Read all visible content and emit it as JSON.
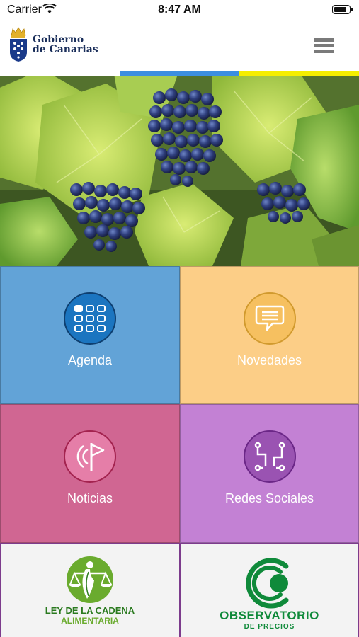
{
  "status_bar": {
    "carrier": "Carrier",
    "time": "8:47 AM"
  },
  "header": {
    "logo_line1": "Gobierno",
    "logo_line2": "de Canarias"
  },
  "tiles": [
    {
      "label": "Agenda",
      "icon": "calendar-grid-icon",
      "bg": "#62a3d7",
      "circle": "#1b75c0"
    },
    {
      "label": "Novedades",
      "icon": "speech-bubble-icon",
      "bg": "#fcce87",
      "circle": "#f6c060"
    },
    {
      "label": "Noticias",
      "icon": "flag-broadcast-icon",
      "bg": "#d06692",
      "circle": "#e57ea8"
    },
    {
      "label": "Redes Sociales",
      "icon": "network-icon",
      "bg": "#c381d4",
      "circle": "#9a53b2"
    }
  ],
  "banners": {
    "left": {
      "line1": "LEY DE LA CADENA",
      "line2": "ALIMENTARIA"
    },
    "right": {
      "line1": "OBSERVATORIO",
      "line2": "DE PRECIOS"
    }
  },
  "colors": {
    "brand_navy": "#1a2e5a",
    "stripe_blue": "#3c8ee0",
    "stripe_yellow": "#f5ee00",
    "banner_green": "#0f8a3a",
    "banner_bg": "#f3f3f3"
  }
}
